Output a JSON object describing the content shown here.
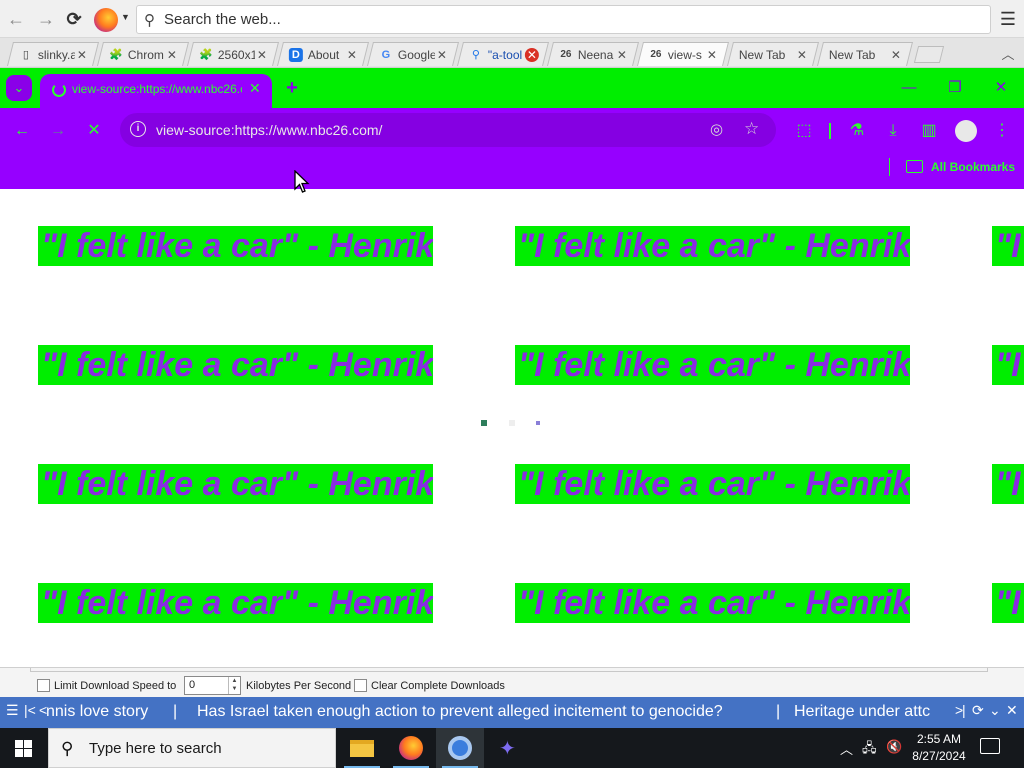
{
  "firefox": {
    "search_placeholder": "Search the web...",
    "tabs": [
      {
        "label": "slinky.a",
        "icon": "page-icon"
      },
      {
        "label": "Chrom",
        "icon": "puzzle-icon"
      },
      {
        "label": "2560x1",
        "icon": "puzzle-icon"
      },
      {
        "label": "About",
        "icon": "d-logo-icon"
      },
      {
        "label": "Google",
        "icon": "google-icon"
      },
      {
        "label": "\"a-tool",
        "icon": "search-icon"
      },
      {
        "label": "Neena",
        "icon": "nbc26-icon"
      },
      {
        "label": "view-s",
        "icon": "nbc26-icon"
      },
      {
        "label": "New Tab",
        "icon": ""
      },
      {
        "label": "New Tab",
        "icon": ""
      }
    ]
  },
  "chrome": {
    "tab_title": "view-source:https://www.nbc26.com/",
    "url": "view-source:https://www.nbc26.com/",
    "bookmarks_label": "All Bookmarks",
    "accent_green": "#00ee00",
    "accent_purple": "#9600ff"
  },
  "page": {
    "banner_text": "\"I felt like a car\" - Henrik",
    "banner_bg": "#00ee00",
    "banner_fg": "#8a2be2"
  },
  "app_panel": {
    "limit_label": "Limit Download Speed to",
    "speed_value": "0",
    "unit_label": "Kilobytes Per Second",
    "clear_label": "Clear Complete Downloads"
  },
  "ticker": {
    "items": [
      "nnis love story",
      "Has Israel taken enough action to prevent alleged incitement to genocide?",
      "Heritage under attc"
    ],
    "left_controls": "≡  |<  <",
    "right_controls": ">  >|  ⟳  ⌄  ✕"
  },
  "taskbar": {
    "search_placeholder": "Type here to search",
    "time": "2:55 AM",
    "date": "8/27/2024"
  }
}
